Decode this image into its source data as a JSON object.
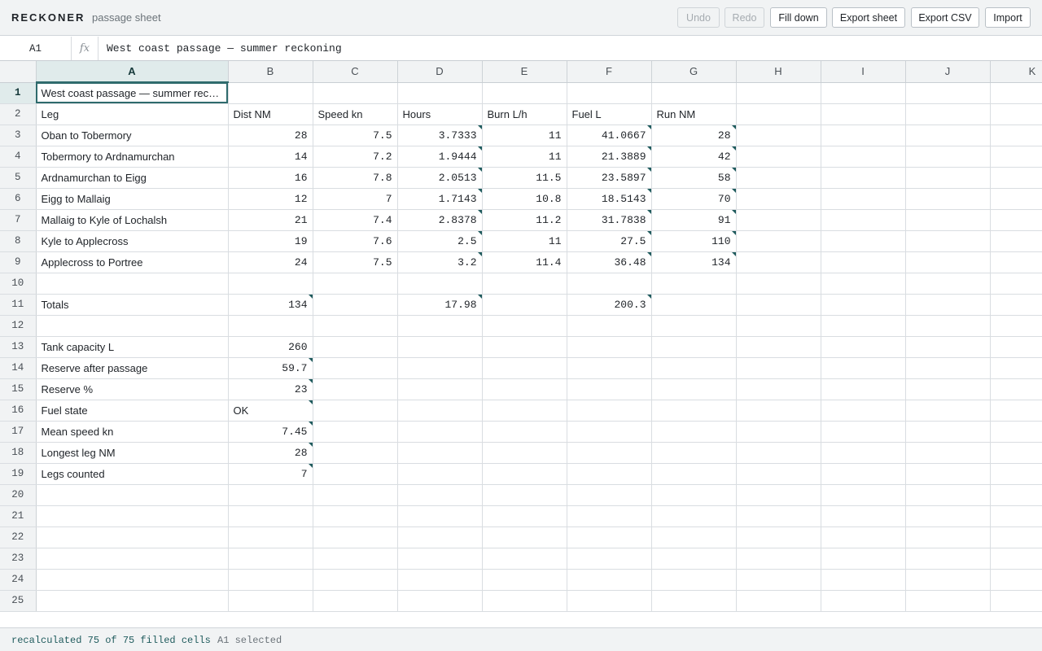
{
  "app": {
    "name": "RECKONER",
    "document": "passage sheet"
  },
  "toolbar": {
    "undo": "Undo",
    "redo": "Redo",
    "fill_down": "Fill down",
    "export_sheet": "Export sheet",
    "export_csv": "Export CSV",
    "import": "Import"
  },
  "formula_bar": {
    "cell_ref": "A1",
    "fx_symbol": "fx",
    "value": "West coast passage — summer reckoning"
  },
  "columns": [
    "A",
    "B",
    "C",
    "D",
    "E",
    "F",
    "G",
    "H",
    "I",
    "J",
    "K"
  ],
  "active": {
    "row": 1,
    "col": "A"
  },
  "rows": [
    {
      "n": "1",
      "cells": [
        "West coast passage — summer reckoning",
        "",
        "",
        "",
        "",
        "",
        "",
        "",
        "",
        "",
        ""
      ]
    },
    {
      "n": "2",
      "cells": [
        "Leg",
        "Dist NM",
        "Speed kn",
        "Hours",
        "Burn L/h",
        "Fuel L",
        "Run NM",
        "",
        "",
        "",
        ""
      ]
    },
    {
      "n": "3",
      "cells": [
        "Oban to Tobermory",
        "28",
        "7.5",
        "3.7333",
        "11",
        "41.0667",
        "28",
        "",
        "",
        "",
        ""
      ]
    },
    {
      "n": "4",
      "cells": [
        "Tobermory to Ardnamurchan",
        "14",
        "7.2",
        "1.9444",
        "11",
        "21.3889",
        "42",
        "",
        "",
        "",
        ""
      ]
    },
    {
      "n": "5",
      "cells": [
        "Ardnamurchan to Eigg",
        "16",
        "7.8",
        "2.0513",
        "11.5",
        "23.5897",
        "58",
        "",
        "",
        "",
        ""
      ]
    },
    {
      "n": "6",
      "cells": [
        "Eigg to Mallaig",
        "12",
        "7",
        "1.7143",
        "10.8",
        "18.5143",
        "70",
        "",
        "",
        "",
        ""
      ]
    },
    {
      "n": "7",
      "cells": [
        "Mallaig to Kyle of Lochalsh",
        "21",
        "7.4",
        "2.8378",
        "11.2",
        "31.7838",
        "91",
        "",
        "",
        "",
        ""
      ]
    },
    {
      "n": "8",
      "cells": [
        "Kyle to Applecross",
        "19",
        "7.6",
        "2.5",
        "11",
        "27.5",
        "110",
        "",
        "",
        "",
        ""
      ]
    },
    {
      "n": "9",
      "cells": [
        "Applecross to Portree",
        "24",
        "7.5",
        "3.2",
        "11.4",
        "36.48",
        "134",
        "",
        "",
        "",
        ""
      ]
    },
    {
      "n": "10",
      "cells": [
        "",
        "",
        "",
        "",
        "",
        "",
        "",
        "",
        "",
        "",
        ""
      ]
    },
    {
      "n": "11",
      "cells": [
        "Totals",
        "134",
        "",
        "17.98",
        "",
        "200.3",
        "",
        "",
        "",
        "",
        ""
      ]
    },
    {
      "n": "12",
      "cells": [
        "",
        "",
        "",
        "",
        "",
        "",
        "",
        "",
        "",
        "",
        ""
      ]
    },
    {
      "n": "13",
      "cells": [
        "Tank capacity L",
        "260",
        "",
        "",
        "",
        "",
        "",
        "",
        "",
        "",
        ""
      ]
    },
    {
      "n": "14",
      "cells": [
        "Reserve after passage",
        "59.7",
        "",
        "",
        "",
        "",
        "",
        "",
        "",
        "",
        ""
      ]
    },
    {
      "n": "15",
      "cells": [
        "Reserve %",
        "23",
        "",
        "",
        "",
        "",
        "",
        "",
        "",
        "",
        ""
      ]
    },
    {
      "n": "16",
      "cells": [
        "Fuel state",
        "OK",
        "",
        "",
        "",
        "",
        "",
        "",
        "",
        "",
        ""
      ]
    },
    {
      "n": "17",
      "cells": [
        "Mean speed kn",
        "7.45",
        "",
        "",
        "",
        "",
        "",
        "",
        "",
        "",
        ""
      ]
    },
    {
      "n": "18",
      "cells": [
        "Longest leg NM",
        "28",
        "",
        "",
        "",
        "",
        "",
        "",
        "",
        "",
        ""
      ]
    },
    {
      "n": "19",
      "cells": [
        "Legs counted",
        "7",
        "",
        "",
        "",
        "",
        "",
        "",
        "",
        "",
        ""
      ]
    },
    {
      "n": "20",
      "cells": [
        "",
        "",
        "",
        "",
        "",
        "",
        "",
        "",
        "",
        "",
        ""
      ]
    },
    {
      "n": "21",
      "cells": [
        "",
        "",
        "",
        "",
        "",
        "",
        "",
        "",
        "",
        "",
        ""
      ]
    },
    {
      "n": "22",
      "cells": [
        "",
        "",
        "",
        "",
        "",
        "",
        "",
        "",
        "",
        "",
        ""
      ]
    },
    {
      "n": "23",
      "cells": [
        "",
        "",
        "",
        "",
        "",
        "",
        "",
        "",
        "",
        "",
        ""
      ]
    },
    {
      "n": "24",
      "cells": [
        "",
        "",
        "",
        "",
        "",
        "",
        "",
        "",
        "",
        "",
        ""
      ]
    },
    {
      "n": "25",
      "cells": [
        "",
        "",
        "",
        "",
        "",
        "",
        "",
        "",
        "",
        "",
        ""
      ]
    }
  ],
  "formula_cells": [
    "D3",
    "F3",
    "G3",
    "D4",
    "F4",
    "G4",
    "D5",
    "F5",
    "G5",
    "D6",
    "F6",
    "G6",
    "D7",
    "F7",
    "G7",
    "D8",
    "F8",
    "G8",
    "D9",
    "F9",
    "G9",
    "B11",
    "D11",
    "F11",
    "B14",
    "B15",
    "B16",
    "B17",
    "B18",
    "B19"
  ],
  "status": {
    "recalc": "recalculated 75 of 75 filled cells",
    "selection": "A1 selected"
  },
  "colors": {
    "accent": "#2f6b6d",
    "formula_marker": "#1f5b5d",
    "chrome_bg": "#f1f3f4"
  }
}
